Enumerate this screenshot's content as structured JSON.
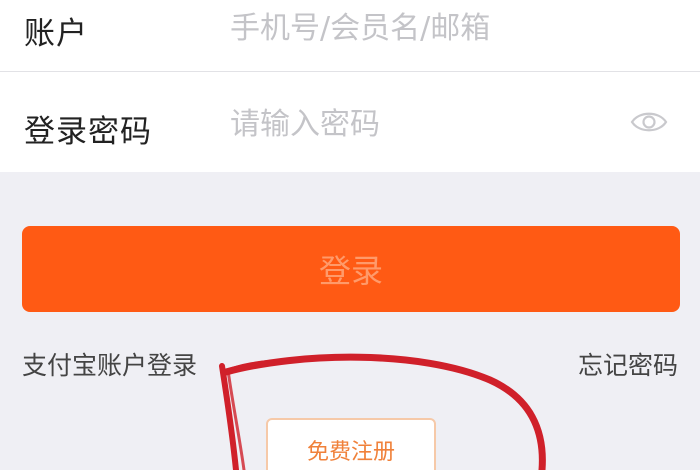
{
  "form": {
    "account_label": "账户",
    "account_placeholder": "手机号/会员名/邮箱",
    "password_label": "登录密码",
    "password_placeholder": "请输入密码",
    "show_password_icon": "eye-icon"
  },
  "actions": {
    "login_label": "登录",
    "alipay_login_label": "支付宝账户登录",
    "forgot_password_label": "忘记密码",
    "register_label": "免费注册"
  },
  "colors": {
    "accent": "#ff5a14",
    "background": "#efeff4",
    "annotation": "#d0202a"
  }
}
